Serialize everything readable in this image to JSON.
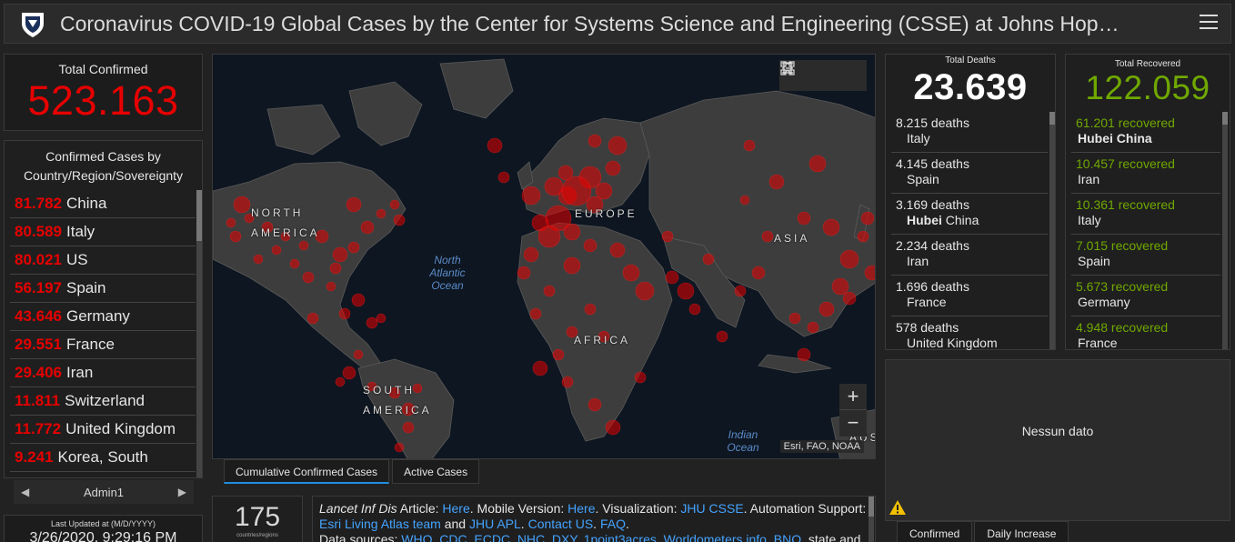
{
  "header": {
    "title": "Coronavirus COVID-19 Global Cases by the Center for Systems Science and Engineering (CSSE) at Johns Hop…"
  },
  "total_confirmed": {
    "label": "Total Confirmed",
    "value": "523.163"
  },
  "confirmed_list": {
    "header": "Confirmed Cases by Country/Region/Sovereignty",
    "items": [
      {
        "num": "81.782",
        "name": "China"
      },
      {
        "num": "80.589",
        "name": "Italy"
      },
      {
        "num": "80.021",
        "name": "US"
      },
      {
        "num": "56.197",
        "name": "Spain"
      },
      {
        "num": "43.646",
        "name": "Germany"
      },
      {
        "num": "29.551",
        "name": "France"
      },
      {
        "num": "29.406",
        "name": "Iran"
      },
      {
        "num": "11.811",
        "name": "Switzerland"
      },
      {
        "num": "11.772",
        "name": "United Kingdom"
      },
      {
        "num": "9.241",
        "name": "Korea, South"
      }
    ]
  },
  "admin_nav": {
    "label": "Admin1"
  },
  "last_updated": {
    "label": "Last Updated at (M/D/YYYY)",
    "value": "3/26/2020, 9:29:16 PM"
  },
  "map": {
    "labels": {
      "north_america": "NORTH AMERICA",
      "south_america": "SOUTH AMERICA",
      "europe": "EUROPE",
      "africa": "AFRICA",
      "asia": "ASIA",
      "aus": "AUS"
    },
    "oceans": {
      "north_atlantic": "North Atlantic Ocean",
      "indian": "Indian Ocean"
    },
    "attribution": "Esri, FAO, NOAA",
    "zoom_in": "+",
    "zoom_out": "−",
    "tools": [
      "bookmark-icon",
      "list-icon",
      "qr-icon"
    ]
  },
  "map_tabs": [
    {
      "label": "Cumulative Confirmed Cases",
      "active": true
    },
    {
      "label": "Active Cases",
      "active": false
    }
  ],
  "countries": {
    "count": "175",
    "label": "countries/regions"
  },
  "info": {
    "t1": "Lancet Inf Dis",
    "t2": " Article: ",
    "l1": "Here",
    "t3": ". Mobile Version: ",
    "l2": "Here",
    "t4": ". Visualization: ",
    "l3": "JHU CSSE",
    "t5": ". Automation Support: ",
    "l4": "Esri Living Atlas team",
    "t6": " and ",
    "l5": "JHU APL",
    "t7": ". ",
    "l6": "Contact US",
    "t8": ". ",
    "l7": "FAQ",
    "t9": ".",
    "t10": "Data sources: ",
    "l8": "WHO, CDC, ECDC, NHC, DXY, 1point3acres, Worldometers.info, BNO",
    "t11": ", state and"
  },
  "deaths": {
    "label": "Total Deaths",
    "value": "23.639",
    "items": [
      {
        "v": "8.215 deaths",
        "loc": "Italy",
        "bold": ""
      },
      {
        "v": "4.145 deaths",
        "loc": "Spain",
        "bold": ""
      },
      {
        "v": "3.169 deaths",
        "bold": "Hubei",
        "loc": "China"
      },
      {
        "v": "2.234 deaths",
        "loc": "Iran",
        "bold": ""
      },
      {
        "v": "1.696 deaths",
        "loc": "France",
        "bold": ""
      },
      {
        "v": "578 deaths",
        "loc": "United Kingdom",
        "bold": ""
      }
    ]
  },
  "recovered": {
    "label": "Total Recovered",
    "value": "122.059",
    "items": [
      {
        "v": "61.201 recovered",
        "bold": "Hubei China",
        "loc": ""
      },
      {
        "v": "10.457 recovered",
        "loc": "Iran",
        "bold": ""
      },
      {
        "v": "10.361 recovered",
        "loc": "Italy",
        "bold": ""
      },
      {
        "v": "7.015 recovered",
        "loc": "Spain",
        "bold": ""
      },
      {
        "v": "5.673 recovered",
        "loc": "Germany",
        "bold": ""
      },
      {
        "v": "4.948 recovered",
        "loc": "France",
        "bold": ""
      }
    ]
  },
  "nodata": {
    "text": "Nessun dato"
  },
  "bottom_tabs": [
    {
      "label": "Confirmed"
    },
    {
      "label": "Daily Increase"
    }
  ],
  "colors": {
    "confirmed": "#e60000",
    "recovered": "#70a800",
    "link": "#44a3ff",
    "tab_active": "#1f8fe0"
  }
}
